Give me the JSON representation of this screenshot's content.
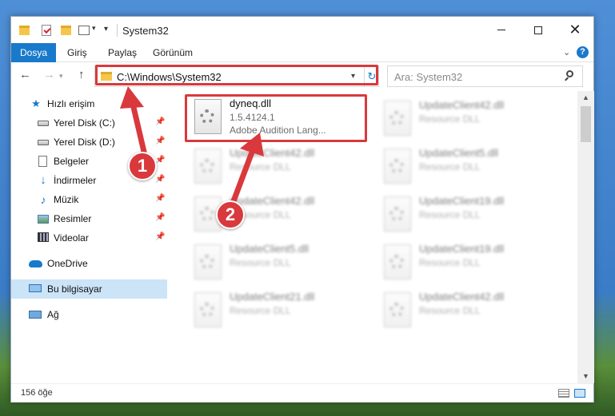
{
  "window": {
    "title": "System32"
  },
  "ribbon": {
    "tabs": [
      "Dosya",
      "Giriş",
      "Paylaş",
      "Görünüm"
    ],
    "help": "?"
  },
  "nav": {
    "address": "C:\\Windows\\System32",
    "search_placeholder": "Ara: System32"
  },
  "sidebar": {
    "items": [
      {
        "label": "Hızlı erişim"
      },
      {
        "label": "Yerel Disk (C:)"
      },
      {
        "label": "Yerel Disk (D:)"
      },
      {
        "label": "Belgeler"
      },
      {
        "label": "İndirmeler"
      },
      {
        "label": "Müzik"
      },
      {
        "label": "Resimler"
      },
      {
        "label": "Videolar"
      },
      {
        "label": "OneDrive"
      },
      {
        "label": "Bu bilgisayar"
      },
      {
        "label": "Ağ"
      }
    ]
  },
  "files": {
    "main": {
      "name": "dyneq.dll",
      "version": "1.5.4124.1",
      "description": "Adobe Audition Lang..."
    },
    "col1": [
      {
        "name": "UpdateClient42.dll",
        "type": "Resource DLL"
      },
      {
        "name": "UpdateClient42.dll",
        "type": "Resource DLL"
      },
      {
        "name": "UpdateClient5.dll",
        "type": "Resource DLL"
      },
      {
        "name": "UpdateClient21.dll",
        "type": "Resource DLL"
      }
    ],
    "col2": [
      {
        "name": "UpdateClient42.dll",
        "type": "Resource DLL"
      },
      {
        "name": "UpdateClient5.dll",
        "type": "Resource DLL"
      },
      {
        "name": "UpdateClient19.dll",
        "type": "Resource DLL"
      },
      {
        "name": "UpdateClient19.dll",
        "type": "Resource DLL"
      },
      {
        "name": "UpdateClient42.dll",
        "type": "Resource DLL"
      }
    ]
  },
  "status": {
    "count": "156 öğe"
  },
  "markers": {
    "one": "1",
    "two": "2"
  },
  "colors": {
    "accent": "#1979ca",
    "highlight": "#d9393c",
    "selected": "#cce4f7"
  }
}
